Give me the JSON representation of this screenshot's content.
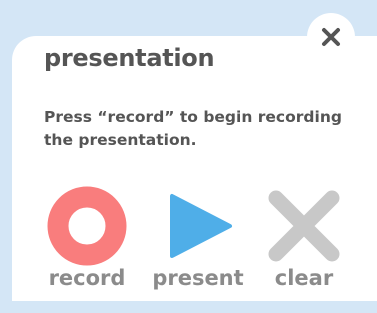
{
  "popup": {
    "title": "presentation",
    "description": "Press “record” to begin recording the presentation.",
    "close_icon": "close-icon",
    "actions": [
      {
        "label": "record",
        "icon": "record-icon",
        "color": "#f97d7d"
      },
      {
        "label": "present",
        "icon": "play-icon",
        "color": "#4faee8"
      },
      {
        "label": "clear",
        "icon": "clear-x-icon",
        "color": "#c8c8c8"
      }
    ]
  },
  "colors": {
    "background": "#d4e6f6",
    "panel": "#ffffff",
    "text": "#555555",
    "label": "#8b8b8b"
  }
}
